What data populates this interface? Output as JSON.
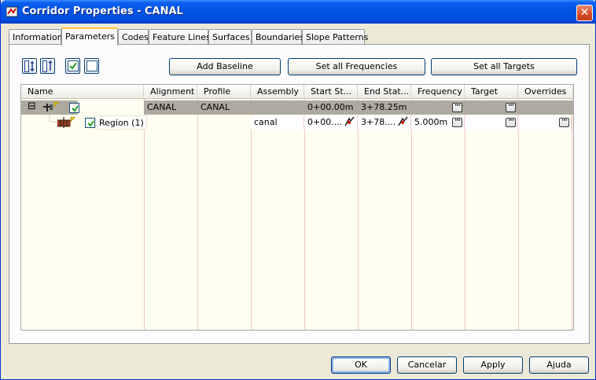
{
  "window": {
    "title": "Corridor Properties - CANAL",
    "close_glyph": "✕"
  },
  "tabs": [
    "Information",
    "Parameters",
    "Codes",
    "Feature Lines",
    "Surfaces",
    "Boundaries",
    "Slope Patterns"
  ],
  "active_tab": "Parameters",
  "toolbar": {
    "add_baseline": "Add Baseline",
    "set_all_frequencies": "Set all Frequencies",
    "set_all_targets": "Set all Targets"
  },
  "grid": {
    "columns": [
      "Name",
      "Alignment",
      "Profile",
      "Assembly",
      "Start St...",
      "End Stat...",
      "Frequency",
      "Target",
      "Overrides"
    ],
    "baseline_row": {
      "expander": "⊟",
      "alignment": "CANAL",
      "profile": "CANAL",
      "start": "0+00.00m",
      "end": "3+78.25m"
    },
    "region_row": {
      "name": "Region (1)",
      "assembly": "canal",
      "start": "0+00....",
      "end": "3+78....",
      "frequency": "5.000m"
    },
    "ellipsis": "···"
  },
  "footer": {
    "ok": "OK",
    "cancel": "Cancelar",
    "apply": "Apply",
    "help": "Ajuda"
  },
  "icons": [
    "corridor-icon",
    "check-all-icon",
    "uncheck-all-icon",
    "pick-station-icon",
    "baseline-icon",
    "region-icon"
  ]
}
